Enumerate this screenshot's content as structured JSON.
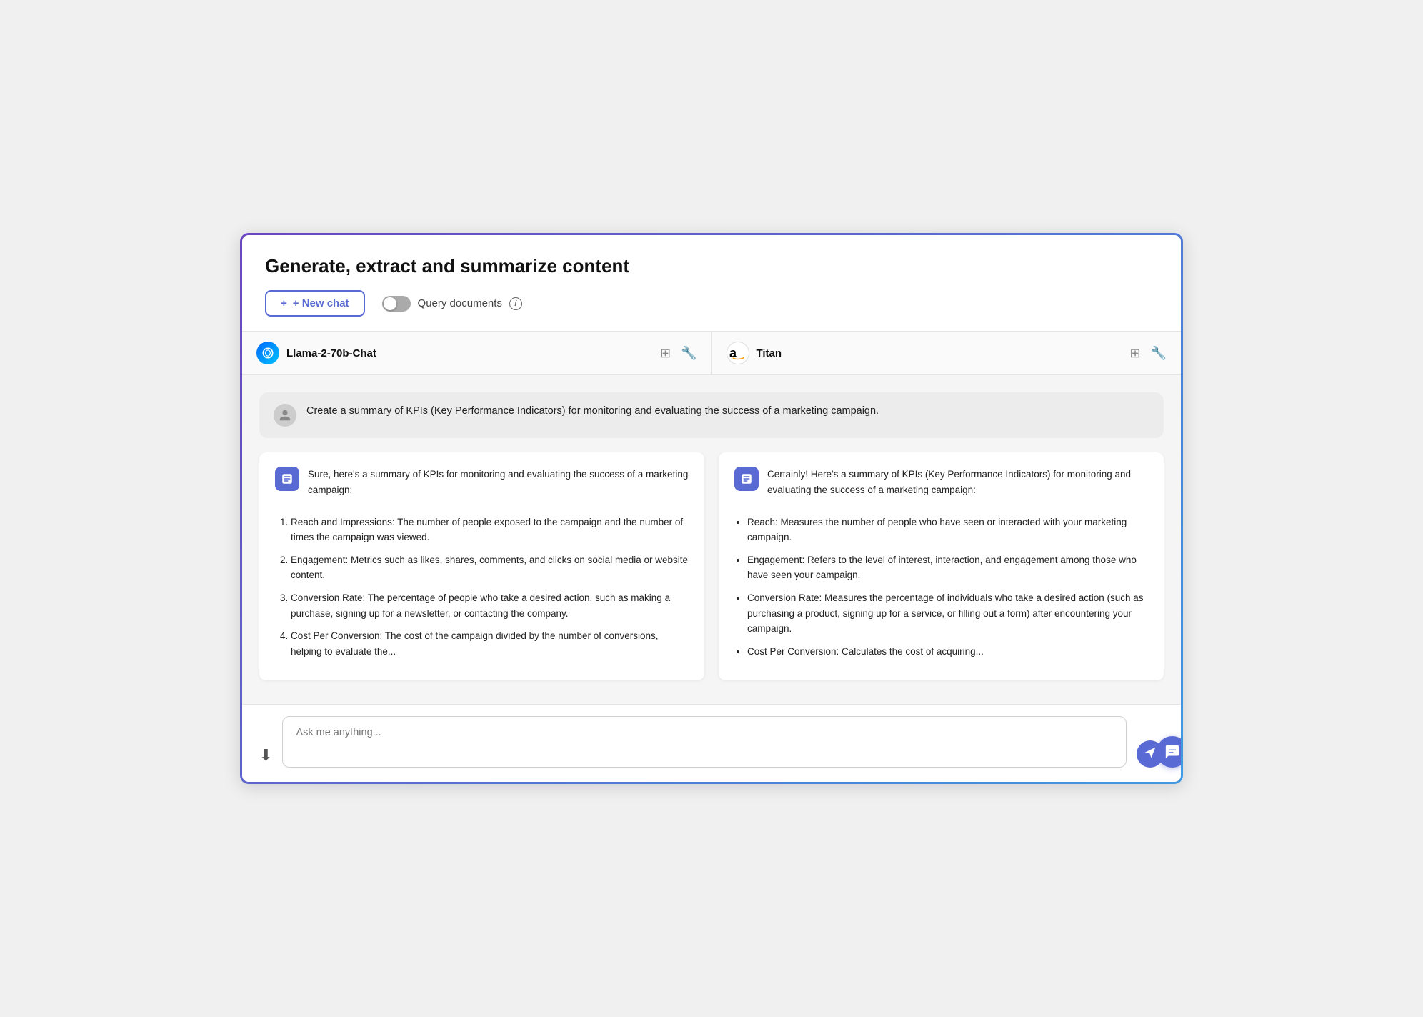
{
  "header": {
    "title": "Generate, extract and summarize content",
    "new_chat_label": "+ New chat",
    "query_docs_label": "Query documents",
    "info_label": "i"
  },
  "models": [
    {
      "id": "llama",
      "icon_type": "meta",
      "icon_label": "∞",
      "name": "Llama-2-70b-Chat"
    },
    {
      "id": "titan",
      "icon_type": "amazon",
      "icon_label": "a",
      "name": "Titan"
    }
  ],
  "user_message": "Create a summary of KPIs (Key Performance Indicators) for monitoring and evaluating the success of a marketing campaign.",
  "responses": [
    {
      "id": "llama-response",
      "intro": "Sure, here's a summary of KPIs for monitoring and evaluating the success of a marketing campaign:",
      "list_type": "numbered",
      "items": [
        "Reach and Impressions: The number of people exposed to the campaign and the number of times the campaign was viewed.",
        "Engagement: Metrics such as likes, shares, comments, and clicks on social media or website content.",
        "Conversion Rate: The percentage of people who take a desired action, such as making a purchase, signing up for a newsletter, or contacting the company.",
        "Cost Per Conversion: The cost of the campaign divided by the number of conversions, helping to evaluate the..."
      ]
    },
    {
      "id": "titan-response",
      "intro": "Certainly! Here's a summary of KPIs (Key Performance Indicators) for monitoring and evaluating the success of a marketing campaign:",
      "list_type": "bullet",
      "items": [
        "Reach: Measures the number of people who have seen or interacted with your marketing campaign.",
        "Engagement: Refers to the level of interest, interaction, and engagement among those who have seen your campaign.",
        "Conversion Rate: Measures the percentage of individuals who take a desired action (such as purchasing a product, signing up for a service, or filling out a form) after encountering your campaign.",
        "Cost Per Conversion: Calculates the cost of acquiring..."
      ]
    }
  ],
  "input": {
    "placeholder": "Ask me anything..."
  }
}
